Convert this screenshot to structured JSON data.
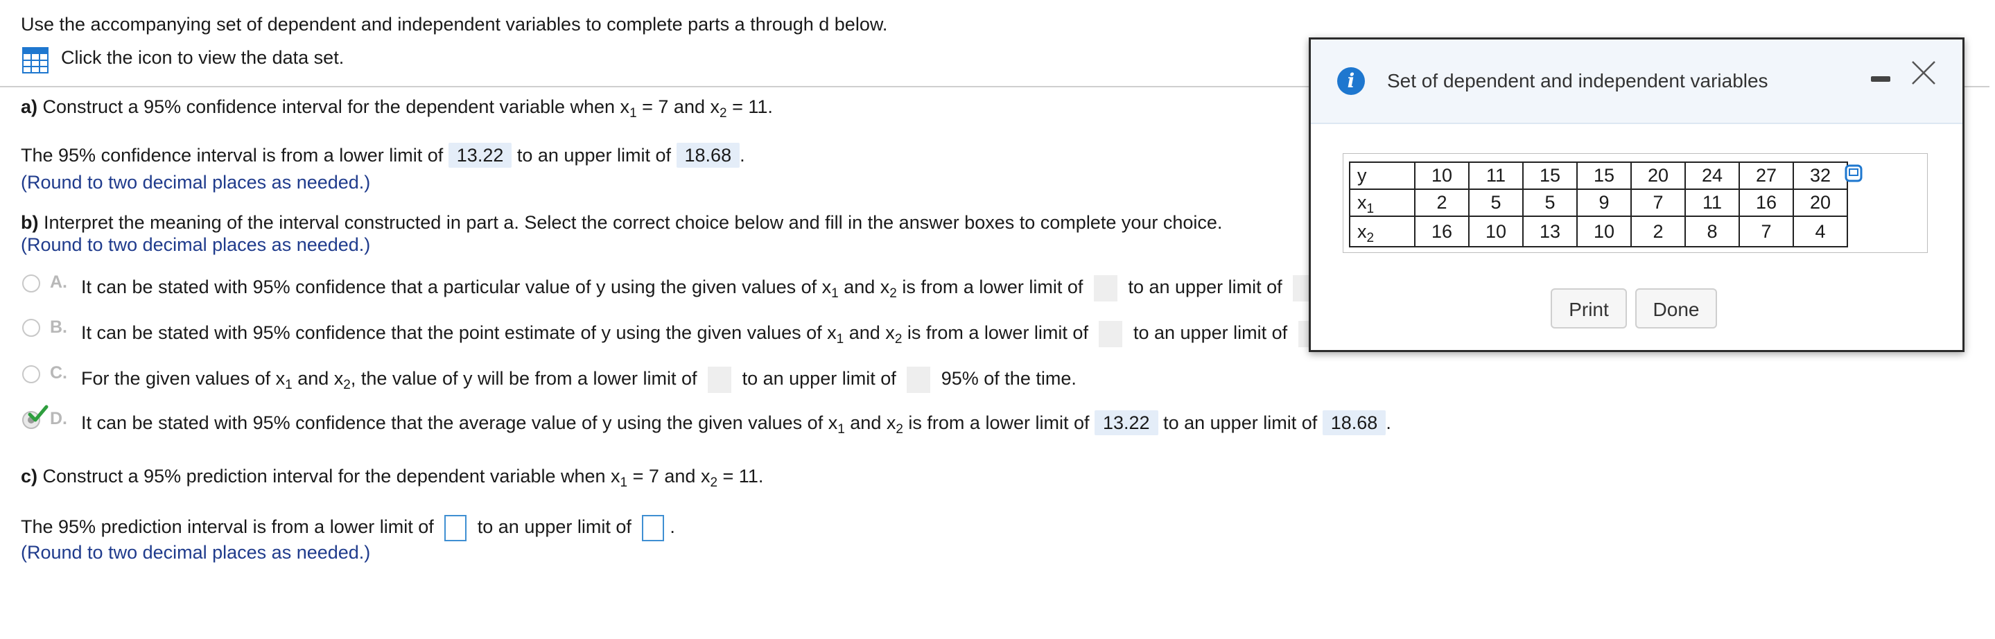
{
  "intro": "Use the accompanying set of dependent and independent variables to complete parts a through d below.",
  "data_link": "Click the icon to view the data set.",
  "part_a": {
    "label": "a)",
    "question_pre": "Construct a 95% confidence interval for the dependent variable when x",
    "question_mid": " = 7 and x",
    "question_post": " = 11.",
    "answer_pre": "The 95% confidence interval is from a lower limit of",
    "lower": "13.22",
    "answer_mid": "to an upper limit of",
    "upper": "18.68",
    "answer_end": ".",
    "hint": "(Round to two decimal places as needed.)"
  },
  "part_b": {
    "label": "b)",
    "question": "Interpret the meaning of the interval constructed in part a. Select the correct choice below and fill in the answer boxes to complete your choice.",
    "hint": "(Round to two decimal places as needed.)",
    "A": {
      "letter": "A.",
      "t1": "It can be stated with 95% confidence that a particular value of y using the given values of x",
      "t2": " and x",
      "t3": " is from a lower limit of",
      "t4": "to an upper limit of",
      "t5": "."
    },
    "B": {
      "letter": "B.",
      "t1": "It can be stated with 95% confidence that the point estimate of y using the given values of x",
      "t2": " and x",
      "t3": " is from a lower limit of",
      "t4": "to an upper limit of",
      "t5": "."
    },
    "C": {
      "letter": "C.",
      "t1": "For the given values of x",
      "t2": " and x",
      "t3": ", the value of y will be from a lower limit of",
      "t4": "to an upper limit of",
      "t5": "95% of the time."
    },
    "D": {
      "letter": "D.",
      "t1": "It can be stated with 95% confidence that the average value of y using the given values of x",
      "t2": " and x",
      "t3": " is from a lower limit of",
      "lower": "13.22",
      "t4": "to an upper limit of",
      "upper": "18.68",
      "t5": "."
    }
  },
  "part_c": {
    "label": "c)",
    "question_pre": "Construct a 95% prediction interval for the dependent variable when x",
    "question_mid": " = 7 and x",
    "question_post": " = 11.",
    "answer_pre": "The 95% prediction interval is from a lower limit of",
    "answer_mid": "to an upper limit of",
    "answer_end": ".",
    "hint": "(Round to two decimal places as needed.)"
  },
  "sub1": "1",
  "sub2": "2",
  "dialog": {
    "title": "Set of dependent and independent variables",
    "info_icon_glyph": "i",
    "rows": [
      {
        "name": "y",
        "sub": "",
        "values": [
          "10",
          "11",
          "15",
          "15",
          "20",
          "24",
          "27",
          "32"
        ]
      },
      {
        "name": "x",
        "sub": "1",
        "values": [
          "2",
          "5",
          "5",
          "9",
          "7",
          "11",
          "16",
          "20"
        ]
      },
      {
        "name": "x",
        "sub": "2",
        "values": [
          "16",
          "10",
          "13",
          "10",
          "2",
          "8",
          "7",
          "4"
        ]
      }
    ],
    "print_label": "Print",
    "done_label": "Done"
  },
  "colors": {
    "accent": "#1e77cf",
    "hint": "#1f3b8c",
    "filled_bg": "#e4edf8",
    "check": "#2e9e3e"
  },
  "icons": {
    "data_set": "grid-table-icon",
    "info": "info-icon",
    "minimize": "minimize-icon",
    "close": "close-icon",
    "copy": "copy-icon",
    "check": "checkmark-icon"
  }
}
